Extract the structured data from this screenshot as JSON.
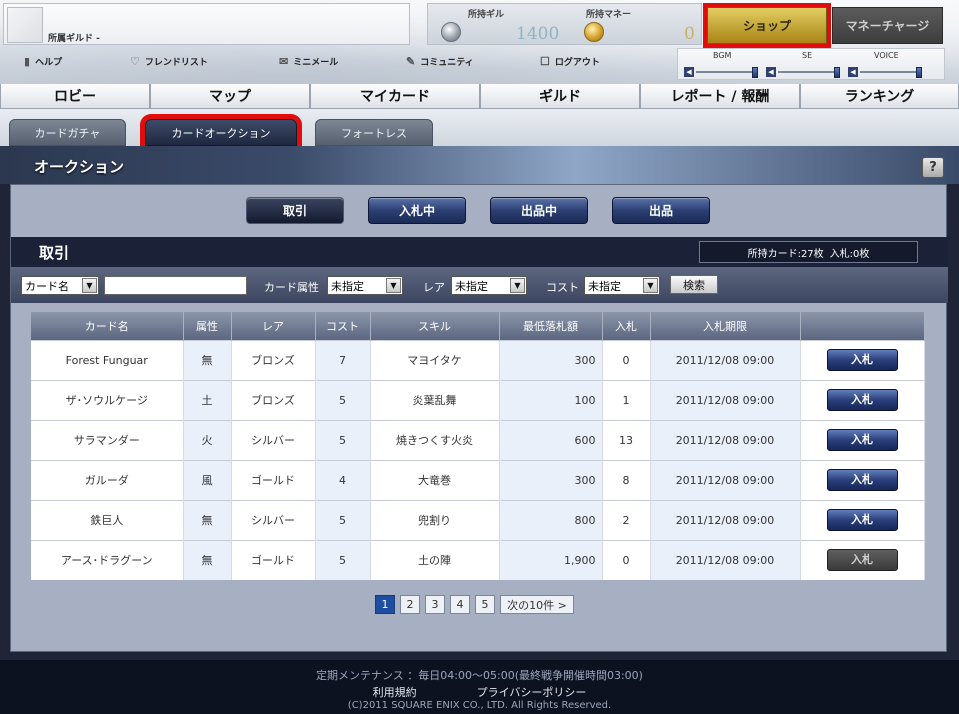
{
  "header": {
    "guild_label": "所属ギルド -",
    "gil_title": "所持ギル",
    "gil_value": "1400",
    "money_title": "所持マネー",
    "money_value": "0",
    "shop_label": "ショップ",
    "charge_label": "マネーチャージ",
    "highlight_color": "#e10d0d"
  },
  "utility_links": [
    {
      "label": "ヘルプ",
      "icon": "bookmark-icon"
    },
    {
      "label": "フレンドリスト",
      "icon": "heart-icon"
    },
    {
      "label": "ミニメール",
      "icon": "mail-icon"
    },
    {
      "label": "コミュニティ",
      "icon": "community-icon"
    },
    {
      "label": "ログアウト",
      "icon": "logout-icon"
    }
  ],
  "sound": {
    "bgm_label": "BGM",
    "se_label": "SE",
    "voice_label": "VOICE"
  },
  "main_nav": [
    "ロビー",
    "マップ",
    "マイカード",
    "ギルド",
    "レポート / 報酬",
    "ランキング"
  ],
  "sub_tabs": {
    "gacha": "カードガチャ",
    "auction": "カードオークション",
    "fortress": "フォートレス"
  },
  "section_title": "オークション",
  "help_symbol": "?",
  "modes": [
    "取引",
    "入札中",
    "出品中",
    "出品"
  ],
  "trade": {
    "title": "取引",
    "owned_cards": "所持カード:27枚",
    "bids": "入札:0枚"
  },
  "filters": {
    "name_select": "カード名",
    "search_text": "",
    "attribute_label": "カード属性",
    "attribute_value": "未指定",
    "rarity_label": "レア",
    "rarity_value": "未指定",
    "cost_label": "コスト",
    "cost_value": "未指定",
    "search_button": "検索"
  },
  "table": {
    "headers": [
      "カード名",
      "属性",
      "レア",
      "コスト",
      "スキル",
      "最低落札額",
      "入札",
      "入札期限",
      ""
    ],
    "rows": [
      {
        "name": "Forest Funguar",
        "attr": "無",
        "rarity": "ブロンズ",
        "cost": "7",
        "skill": "マヨイタケ",
        "min_price": "300",
        "bids": "0",
        "deadline": "2011/12/08 09:00",
        "action": "入札",
        "enabled": true
      },
      {
        "name": "ザ･ソウルケージ",
        "attr": "土",
        "rarity": "ブロンズ",
        "cost": "5",
        "skill": "炎葉乱舞",
        "min_price": "100",
        "bids": "1",
        "deadline": "2011/12/08 09:00",
        "action": "入札",
        "enabled": true
      },
      {
        "name": "サラマンダー",
        "attr": "火",
        "rarity": "シルバー",
        "cost": "5",
        "skill": "焼きつくす火炎",
        "min_price": "600",
        "bids": "13",
        "deadline": "2011/12/08 09:00",
        "action": "入札",
        "enabled": true
      },
      {
        "name": "ガルーダ",
        "attr": "風",
        "rarity": "ゴールド",
        "cost": "4",
        "skill": "大竜巻",
        "min_price": "300",
        "bids": "8",
        "deadline": "2011/12/08 09:00",
        "action": "入札",
        "enabled": true
      },
      {
        "name": "鉄巨人",
        "attr": "無",
        "rarity": "シルバー",
        "cost": "5",
        "skill": "兜割り",
        "min_price": "800",
        "bids": "2",
        "deadline": "2011/12/08 09:00",
        "action": "入札",
        "enabled": true
      },
      {
        "name": "アース･ドラグーン",
        "attr": "無",
        "rarity": "ゴールド",
        "cost": "5",
        "skill": "土の陣",
        "min_price": "1,900",
        "bids": "0",
        "deadline": "2011/12/08 09:00",
        "action": "入札",
        "enabled": false
      }
    ]
  },
  "pagination": {
    "pages": [
      "1",
      "2",
      "3",
      "4",
      "5"
    ],
    "current": "1",
    "next_label": "次の10件 >"
  },
  "footer": {
    "maintenance": "定期メンテナンス ：毎日04:00～05:00(最終戦争開催時間03:00)",
    "terms": "利用規約",
    "privacy": "プライバシーポリシー",
    "copyright": "(C)2011 SQUARE ENIX CO., LTD. All Rights Reserved."
  }
}
